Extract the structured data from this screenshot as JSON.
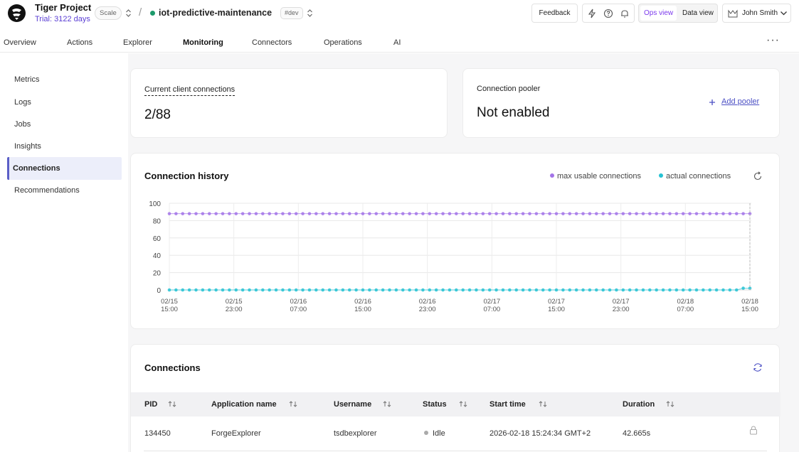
{
  "project": {
    "name": "Tiger Project",
    "trial": "Trial: 3122 days",
    "plan_badge": "Scale"
  },
  "service": {
    "name": "iot-predictive-maintenance",
    "env_badge": "#dev",
    "status_color": "#1c9a6b"
  },
  "header": {
    "feedback_label": "Feedback",
    "ops_view_label": "Ops view",
    "data_view_label": "Data view",
    "user_name": "John Smith"
  },
  "tabs": [
    {
      "label": "Overview"
    },
    {
      "label": "Actions"
    },
    {
      "label": "Explorer"
    },
    {
      "label": "Monitoring",
      "active": true
    },
    {
      "label": "Connectors"
    },
    {
      "label": "Operations"
    },
    {
      "label": "AI"
    }
  ],
  "sidebar": {
    "items": [
      {
        "label": "Metrics"
      },
      {
        "label": "Logs"
      },
      {
        "label": "Jobs"
      },
      {
        "label": "Insights"
      },
      {
        "label": "Connections",
        "active": true
      },
      {
        "label": "Recommendations"
      }
    ]
  },
  "client_connections": {
    "label": "Current client connections",
    "value": "2/88"
  },
  "pooler": {
    "label": "Connection pooler",
    "value": "Not enabled",
    "add_label": "Add pooler"
  },
  "history": {
    "title": "Connection history"
  },
  "chart_data": {
    "type": "line",
    "ylim": [
      0,
      100
    ],
    "yticks": [
      "0",
      "20",
      "40",
      "60",
      "80",
      "100"
    ],
    "xticks": [
      [
        "02/15",
        "15:00"
      ],
      [
        "02/15",
        "23:00"
      ],
      [
        "02/16",
        "07:00"
      ],
      [
        "02/16",
        "15:00"
      ],
      [
        "02/16",
        "23:00"
      ],
      [
        "02/17",
        "07:00"
      ],
      [
        "02/17",
        "15:00"
      ],
      [
        "02/17",
        "23:00"
      ],
      [
        "02/18",
        "07:00"
      ],
      [
        "02/18",
        "15:00"
      ]
    ],
    "series": [
      {
        "name": "max usable connections",
        "color": "#a374e8",
        "values": [
          88,
          88,
          88,
          88,
          88,
          88,
          88,
          88,
          88,
          88,
          88,
          88,
          88,
          88,
          88,
          88,
          88,
          88,
          88,
          88,
          88,
          88,
          88,
          88,
          88,
          88,
          88,
          88,
          88,
          88,
          88,
          88,
          88,
          88,
          88,
          88,
          88,
          88,
          88,
          88,
          88,
          88,
          88,
          88,
          88,
          88,
          88,
          88,
          88,
          88,
          88,
          88,
          88,
          88,
          88,
          88,
          88,
          88,
          88,
          88,
          88,
          88,
          88,
          88,
          88,
          88,
          88,
          88,
          88,
          88,
          88,
          88,
          88,
          88,
          88,
          88,
          88,
          88,
          88,
          88,
          88,
          88,
          88,
          88,
          88,
          88,
          88,
          88
        ]
      },
      {
        "name": "actual connections",
        "color": "#25c2d3",
        "values": [
          0,
          0,
          0,
          0,
          0,
          0,
          0,
          0,
          0,
          0,
          0,
          0,
          0,
          0,
          0,
          0,
          0,
          0,
          0,
          0,
          0,
          0,
          0,
          0,
          0,
          0,
          0,
          0,
          0,
          0,
          0,
          0,
          0,
          0,
          0,
          0,
          0,
          0,
          0,
          0,
          0,
          0,
          0,
          0,
          0,
          0,
          0,
          0,
          0,
          0,
          0,
          0,
          0,
          0,
          0,
          0,
          0,
          0,
          0,
          0,
          0,
          0,
          0,
          0,
          0,
          0,
          0,
          0,
          0,
          0,
          0,
          0,
          0,
          0,
          0,
          0,
          0,
          0,
          0,
          0,
          0,
          0,
          0,
          0,
          0,
          0,
          2,
          2
        ]
      }
    ],
    "grid": true,
    "legend": "top-right"
  },
  "connections": {
    "title": "Connections",
    "columns": [
      "PID",
      "Application name",
      "Username",
      "Status",
      "Start time",
      "Duration"
    ],
    "rows": [
      {
        "pid": "134450",
        "app": "ForgeExplorer",
        "user": "tsdbexplorer",
        "status": "Idle",
        "start": "2026-02-18 15:24:34 GMT+2",
        "duration": "42.665s"
      }
    ]
  }
}
